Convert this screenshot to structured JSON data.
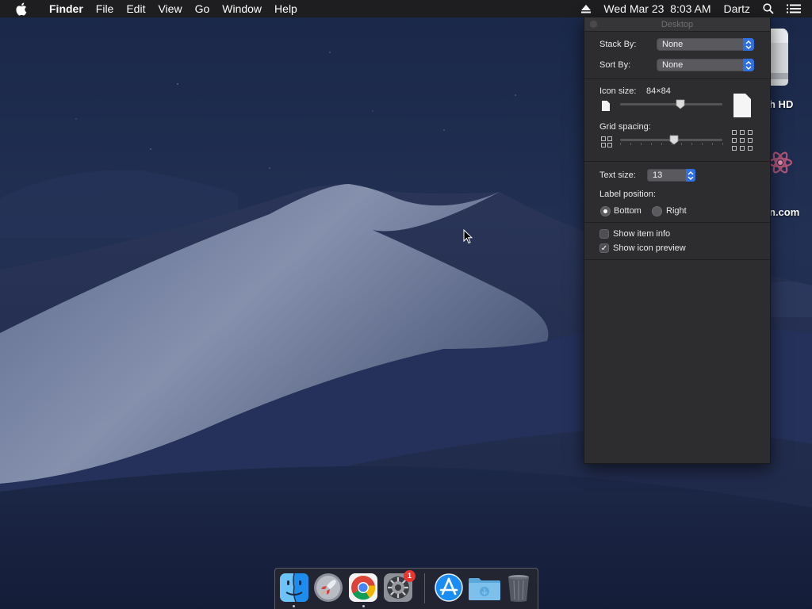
{
  "menubar": {
    "apple_icon": "apple-icon",
    "app_name": "Finder",
    "menus": [
      "File",
      "Edit",
      "View",
      "Go",
      "Window",
      "Help"
    ],
    "eject_icon": "eject-icon",
    "clock": "Wed Mar 23  8:03 AM",
    "user": "Dartz",
    "spotlight_icon": "search-icon",
    "notification_icon": "list-icon"
  },
  "desktop": {
    "items": [
      {
        "label": "h HD",
        "icon": "hard-drive-icon"
      },
      {
        "label": "n.com",
        "icon": "app-icon"
      }
    ]
  },
  "view_options": {
    "title": "Desktop",
    "stack_by_label": "Stack By:",
    "stack_by_value": "None",
    "sort_by_label": "Sort By:",
    "sort_by_value": "None",
    "icon_size_label": "Icon size:",
    "icon_size_value": "84×84",
    "icon_size_fraction": 0.59,
    "grid_spacing_label": "Grid spacing:",
    "grid_spacing_fraction": 0.53,
    "text_size_label": "Text size:",
    "text_size_value": "13",
    "label_position_label": "Label position:",
    "label_position_bottom": "Bottom",
    "label_position_right": "Right",
    "label_position_selected": "Bottom",
    "show_item_info_label": "Show item info",
    "show_item_info_checked": false,
    "show_icon_preview_label": "Show icon preview",
    "show_icon_preview_checked": true
  },
  "dock": {
    "items": [
      {
        "name": "Finder",
        "icon": "finder-icon",
        "running": true
      },
      {
        "name": "Launchpad",
        "icon": "launchpad-icon",
        "running": false
      },
      {
        "name": "Google Chrome",
        "icon": "chrome-icon",
        "running": true
      },
      {
        "name": "System Preferences",
        "icon": "system-preferences-icon",
        "running": false,
        "badge": "1"
      },
      {
        "name": "App Store",
        "icon": "app-store-icon",
        "running": false
      },
      {
        "name": "Downloads",
        "icon": "downloads-folder-icon",
        "running": false
      },
      {
        "name": "Trash",
        "icon": "trash-icon",
        "running": false
      }
    ]
  },
  "colors": {
    "menubar_bg": "#1e1e20",
    "panel_bg": "#2d2d2f",
    "accent_blue": "#2f6fe0",
    "badge_red": "#e8352e",
    "sky_top": "#1a2748",
    "dune_light": "#8590ad"
  }
}
